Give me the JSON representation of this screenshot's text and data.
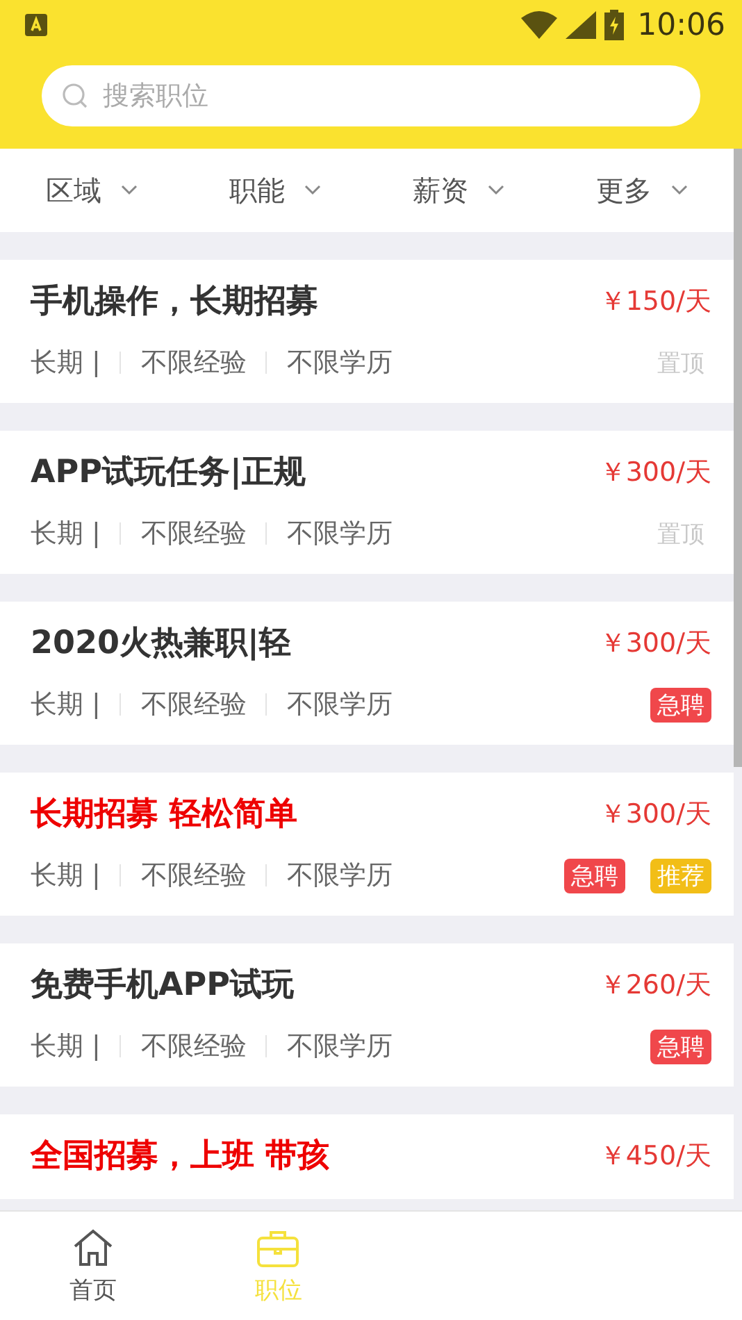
{
  "status_bar": {
    "time": "10:06"
  },
  "search": {
    "placeholder": "搜索职位"
  },
  "filters": [
    {
      "label": "区域"
    },
    {
      "label": "职能"
    },
    {
      "label": "薪资"
    },
    {
      "label": "更多"
    }
  ],
  "jobs": [
    {
      "title": "手机操作，长期招募",
      "highlight": false,
      "salary": "￥150/天",
      "meta": [
        "长期 |",
        "不限经验",
        "不限学历"
      ],
      "tags": [
        {
          "kind": "pin",
          "label": "置顶"
        }
      ]
    },
    {
      "title": "APP试玩任务|正规",
      "highlight": false,
      "salary": "￥300/天",
      "meta": [
        "长期 |",
        "不限经验",
        "不限学历"
      ],
      "tags": [
        {
          "kind": "pin",
          "label": "置顶"
        }
      ]
    },
    {
      "title": "2020火热兼职|轻",
      "highlight": false,
      "salary": "￥300/天",
      "meta": [
        "长期 |",
        "不限经验",
        "不限学历"
      ],
      "tags": [
        {
          "kind": "urgent",
          "label": "急聘"
        }
      ]
    },
    {
      "title": "长期招募 轻松简单",
      "highlight": true,
      "salary": "￥300/天",
      "meta": [
        "长期 |",
        "不限经验",
        "不限学历"
      ],
      "tags": [
        {
          "kind": "urgent",
          "label": "急聘"
        },
        {
          "kind": "recommend",
          "label": "推荐"
        }
      ]
    },
    {
      "title": "免费手机APP试玩",
      "highlight": false,
      "salary": "￥260/天",
      "meta": [
        "长期 |",
        "不限经验",
        "不限学历"
      ],
      "tags": [
        {
          "kind": "urgent",
          "label": "急聘"
        }
      ]
    },
    {
      "title": "全国招募，上班 带孩",
      "highlight": true,
      "salary": "￥450/天"
    }
  ],
  "nav": [
    {
      "label": "首页",
      "selected": false
    },
    {
      "label": "职位",
      "selected": true
    }
  ]
}
